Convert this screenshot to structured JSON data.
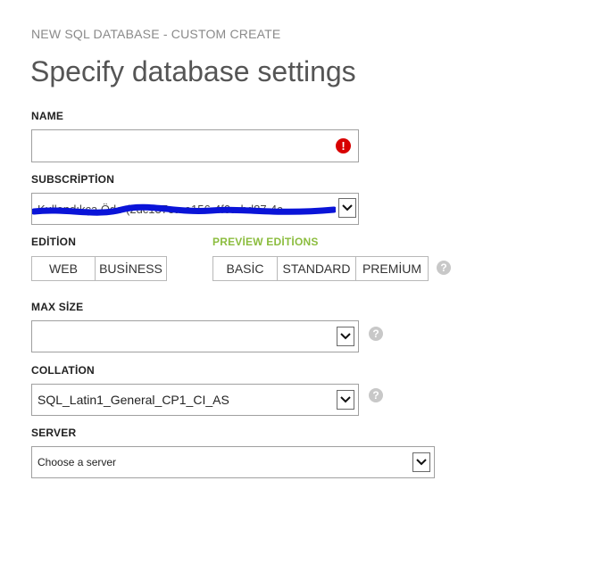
{
  "wizard_title": "NEW SQL DATABASE - CUSTOM CREATE",
  "page_title": "Specify database settings",
  "name": {
    "label": "NAME",
    "value": "",
    "error_icon": "exclamation-icon",
    "error_color": "#d80000"
  },
  "subscription": {
    "label": "SUBSCRİPTİON",
    "value": "Kullandıkça Öde (2dc137ea-a156-4f0a-bd87-4c",
    "redaction_color": "#0a14d8"
  },
  "edition": {
    "label": "EDİTİON",
    "options": [
      "WEB",
      "BUSİNESS"
    ]
  },
  "preview_editions": {
    "label": "PREVİEW EDİTİONS",
    "options": [
      "BASİC",
      "STANDARD",
      "PREMİUM"
    ],
    "label_color": "#8cbd3f"
  },
  "max_size": {
    "label": "MAX SİZE",
    "value": ""
  },
  "collation": {
    "label": "COLLATİON",
    "value": "SQL_Latin1_General_CP1_CI_AS"
  },
  "server": {
    "label": "SERVER",
    "value": "Choose a server"
  },
  "icons": {
    "help": "?",
    "error": "!"
  }
}
